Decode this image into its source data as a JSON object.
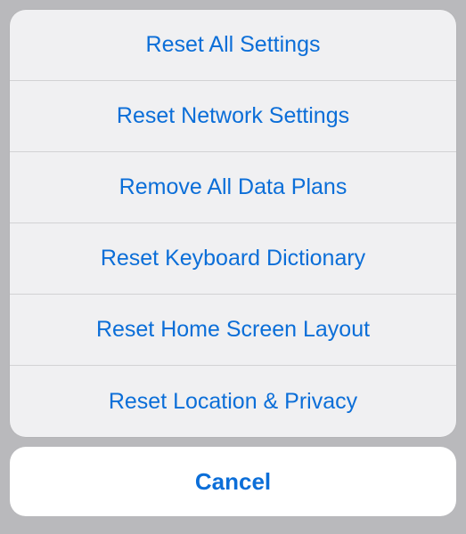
{
  "sheet": {
    "options": [
      {
        "label": "Reset All Settings"
      },
      {
        "label": "Reset Network Settings"
      },
      {
        "label": "Remove All Data Plans"
      },
      {
        "label": "Reset Keyboard Dictionary"
      },
      {
        "label": "Reset Home Screen Layout"
      },
      {
        "label": "Reset Location & Privacy"
      }
    ],
    "cancel_label": "Cancel"
  }
}
